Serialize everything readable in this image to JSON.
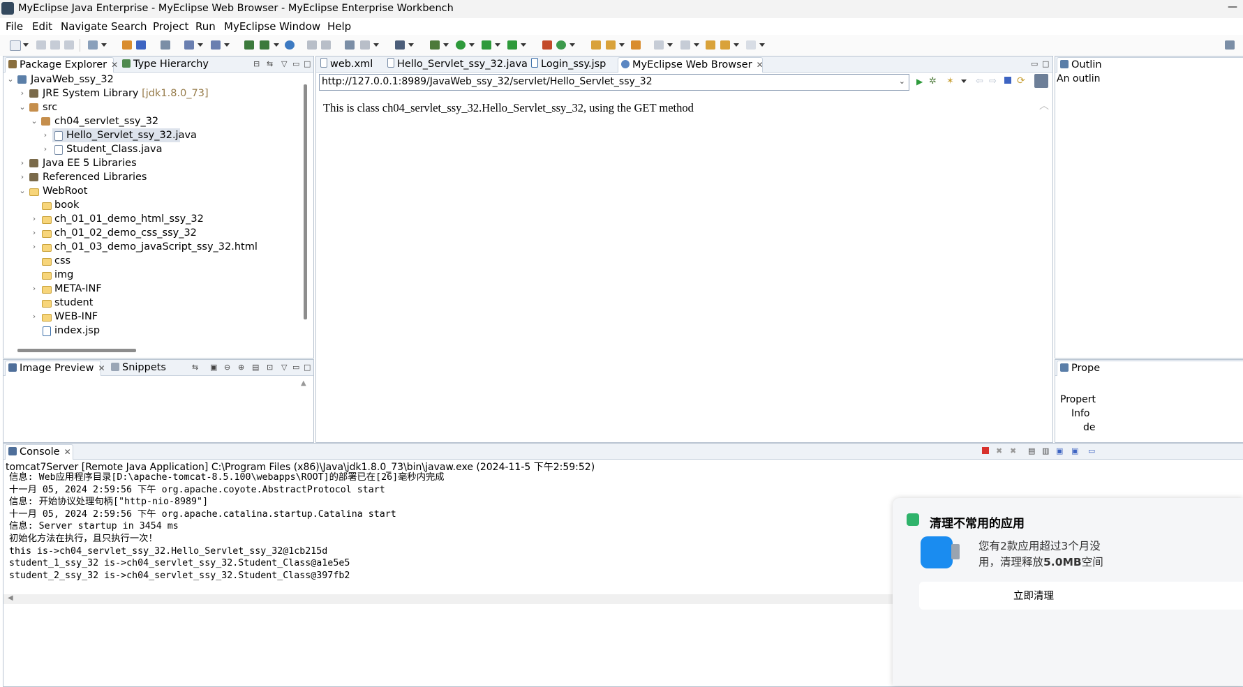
{
  "window": {
    "title": "MyEclipse Java Enterprise - MyEclipse Web Browser - MyEclipse Enterprise Workbench",
    "minimize_glyph": "—"
  },
  "menu": [
    "File",
    "Edit",
    "Navigate",
    "Search",
    "Project",
    "Run",
    "MyEclipse",
    "Window",
    "Help"
  ],
  "package_explorer": {
    "tabs": [
      "Package Explorer",
      "Type Hierarchy"
    ],
    "tree": [
      {
        "label": "JavaWeb_ssy_32",
        "icon": "project-icon",
        "expanded": true
      },
      {
        "label": "JRE System Library",
        "extra": "[jdk1.8.0_73]",
        "icon": "library-icon"
      },
      {
        "label": "src",
        "icon": "source-folder-icon",
        "expanded": true
      },
      {
        "label": "ch04_servlet_ssy_32",
        "icon": "package-icon",
        "expanded": true
      },
      {
        "label": "Hello_Servlet_ssy_32.java",
        "icon": "java-file-icon",
        "selected": true
      },
      {
        "label": "Student_Class.java",
        "icon": "java-file-icon"
      },
      {
        "label": "Java EE 5 Libraries",
        "icon": "library-icon"
      },
      {
        "label": "Referenced Libraries",
        "icon": "library-icon"
      },
      {
        "label": "WebRoot",
        "icon": "folder-icon",
        "expanded": true
      },
      {
        "label": "book",
        "icon": "folder-icon"
      },
      {
        "label": "ch_01_01_demo_html_ssy_32",
        "icon": "folder-icon"
      },
      {
        "label": "ch_01_02_demo_css_ssy_32",
        "icon": "folder-icon"
      },
      {
        "label": "ch_01_03_demo_javaScript_ssy_32.html",
        "icon": "folder-icon"
      },
      {
        "label": "css",
        "icon": "folder-icon"
      },
      {
        "label": "img",
        "icon": "folder-icon"
      },
      {
        "label": "META-INF",
        "icon": "folder-icon"
      },
      {
        "label": "student",
        "icon": "folder-icon"
      },
      {
        "label": "WEB-INF",
        "icon": "folder-icon"
      },
      {
        "label": "index.jsp",
        "icon": "jsp-file-icon"
      }
    ]
  },
  "image_preview": {
    "tabs": [
      "Image Preview",
      "Snippets"
    ]
  },
  "editor": {
    "tabs": [
      "web.xml",
      "Hello_Servlet_ssy_32.java",
      "Login_ssy.jsp",
      "MyEclipse Web Browser"
    ],
    "active_tab": "MyEclipse Web Browser",
    "url": "http://127.0.0.1:8989/JavaWeb_ssy_32/servlet/Hello_Servlet_ssy_32",
    "page_text": "This is class ch04_servlet_ssy_32.Hello_Servlet_ssy_32, using the GET method"
  },
  "outline": {
    "tab": "Outlin",
    "text": "An outlin"
  },
  "properties": {
    "tab": "Prope",
    "header": "Propert",
    "row1": "Info",
    "row2": "de"
  },
  "console": {
    "tab": "Console",
    "header": "tomcat7Server [Remote Java Application] C:\\Program Files (x86)\\Java\\jdk1.8.0_73\\bin\\javaw.exe (2024-11-5 下午2:59:52)",
    "lines": [
      "信息: Web应用程序目录[D:\\apache-tomcat-8.5.100\\webapps\\ROOT]的部署已在[26]毫秒内完成",
      "十一月 05, 2024 2:59:56 下午 org.apache.coyote.AbstractProtocol start",
      "信息: 开始协议处理句柄[\"http-nio-8989\"]",
      "十一月 05, 2024 2:59:56 下午 org.apache.catalina.startup.Catalina start",
      "信息: Server startup in 3454 ms",
      "初始化方法在执行，且只执行一次！",
      "this is->ch04_servlet_ssy_32.Hello_Servlet_ssy_32@1cb215d",
      "student_1_ssy_32 is->ch04_servlet_ssy_32.Student_Class@a1e5e5",
      "student_2_ssy_32 is->ch04_servlet_ssy_32.Student_Class@397fb2"
    ]
  },
  "notification": {
    "title": "清理不常用的应用",
    "body_line1": "您有2款应用超过3个月没",
    "body_line2_prefix": "用，清理释放",
    "body_line2_bold": "5.0MB",
    "body_line2_suffix": "空间",
    "button": "立即清理"
  },
  "colors": {
    "accent_green": "#2fb36b",
    "notif_app_blue": "#1a8cf0",
    "panel_border": "#b9c4d1"
  }
}
